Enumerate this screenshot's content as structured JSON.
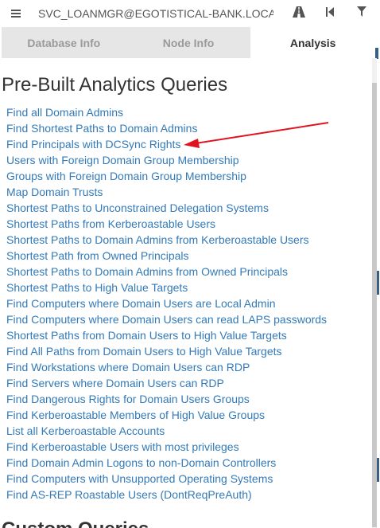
{
  "topbar": {
    "search_value": "SVC_LOANMGR@EGOTISTICAL-BANK.LOCA",
    "icons": [
      "menu-icon",
      "pathfinding-icon",
      "back-icon",
      "filter-icon"
    ]
  },
  "tabs": [
    {
      "label": "Database Info",
      "active": false
    },
    {
      "label": "Node Info",
      "active": false
    },
    {
      "label": "Analysis",
      "active": true
    }
  ],
  "analysis": {
    "section_title": "Pre-Built Analytics Queries",
    "queries": [
      "Find all Domain Admins",
      "Find Shortest Paths to Domain Admins",
      "Find Principals with DCSync Rights",
      "Users with Foreign Domain Group Membership",
      "Groups with Foreign Domain Group Membership",
      "Map Domain Trusts",
      "Shortest Paths to Unconstrained Delegation Systems",
      "Shortest Paths from Kerberoastable Users",
      "Shortest Paths to Domain Admins from Kerberoastable Users",
      "Shortest Path from Owned Principals",
      "Shortest Paths to Domain Admins from Owned Principals",
      "Shortest Paths to High Value Targets",
      "Find Computers where Domain Users are Local Admin",
      "Find Computers where Domain Users can read LAPS passwords",
      "Shortest Paths from Domain Users to High Value Targets",
      "Find All Paths from Domain Users to High Value Targets",
      "Find Workstations where Domain Users can RDP",
      "Find Servers where Domain Users can RDP",
      "Find Dangerous Rights for Domain Users Groups",
      "Find Kerberoastable Members of High Value Groups",
      "List all Kerberoastable Accounts",
      "Find Kerberoastable Users with most privileges",
      "Find Domain Admin Logons to non-Domain Controllers",
      "Find Computers with Unsupported Operating Systems",
      "Find AS-REP Roastable Users (DontReqPreAuth)"
    ],
    "next_section_title": "Custom Queries"
  },
  "colors": {
    "link": "#337ab7",
    "annotation_arrow": "#e0141e",
    "tab_inactive_bg": "#e6e6e6",
    "tab_inactive_text": "#9a9a9a"
  }
}
